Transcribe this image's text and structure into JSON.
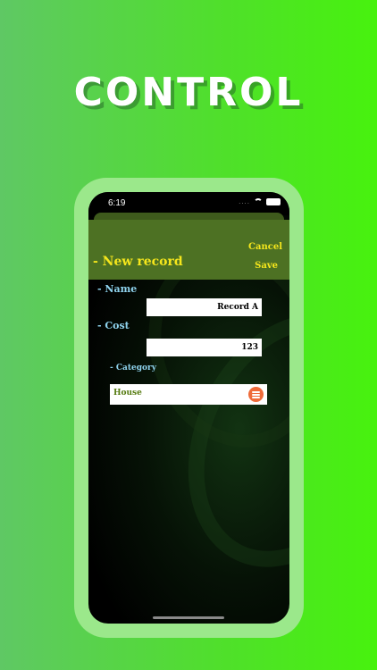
{
  "headline": "CONTROL",
  "status_bar": {
    "time": "6:19",
    "dots": "...."
  },
  "nav": {
    "title": "- New record",
    "cancel_label": "Cancel",
    "save_label": "Save"
  },
  "form": {
    "name_label": "- Name",
    "name_value": "Record A",
    "cost_label": "- Cost",
    "cost_value": "123",
    "category_label": "- Category",
    "category_value": "House"
  },
  "colors": {
    "accent_yellow": "#f5e61c",
    "label_blue": "#8fd3ee",
    "header_green": "#4d7123",
    "category_button": "#ef6b3a"
  },
  "icons": {
    "category_button": "list-icon",
    "wifi": "wifi-icon",
    "battery": "battery-icon"
  }
}
